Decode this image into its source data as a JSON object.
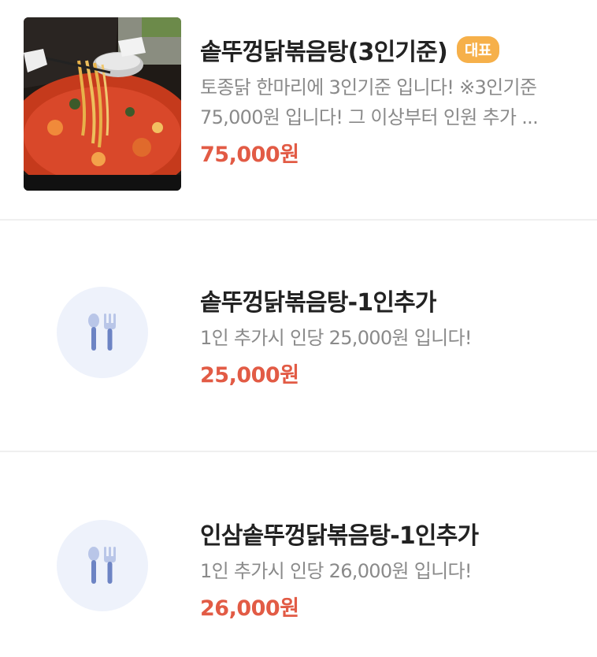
{
  "colors": {
    "accent_price": "#e25b45",
    "badge_bg": "#f6b04a",
    "placeholder_bg": "#eef2fb",
    "icon": "#6d84c4"
  },
  "menu": {
    "items": [
      {
        "name": "솥뚜껑닭볶음탕(3인기준)",
        "badge": "대표",
        "description": "토종닭 한마리에 3인기준 입니다! ※3인기준 75,000원 입니다! 그 이상부터 인원 추가 ...",
        "price": "75,000원",
        "image": "food-photo"
      },
      {
        "name": "솥뚜껑닭볶음탕-1인추가",
        "description": "1인 추가시 인당 25,000원 입니다!",
        "price": "25,000원",
        "image": "utensils-icon"
      },
      {
        "name": "인삼솥뚜껑닭볶음탕-1인추가",
        "description": "1인 추가시 인당 26,000원 입니다!",
        "price": "26,000원",
        "image": "utensils-icon"
      }
    ]
  }
}
